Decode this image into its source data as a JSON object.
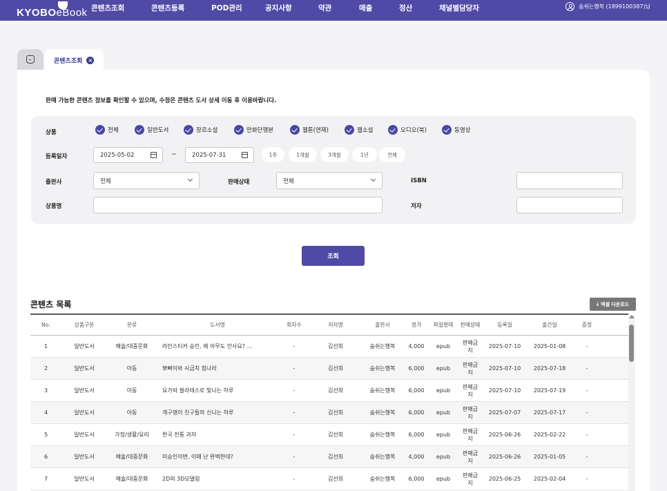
{
  "brand": {
    "bold": "KYOBO",
    "light": "eBook"
  },
  "nav": [
    "콘텐츠조회",
    "콘텐츠등록",
    "POD관리",
    "공지사항",
    "약관",
    "매출",
    "정산",
    "채널별담당자"
  ],
  "user": {
    "label": "숨쉬는행복 (1899100387)님"
  },
  "tab": {
    "label": "콘텐츠조회"
  },
  "notice": "판매 가능한 콘텐츠 정보를 확인할 수 있으며, 수정은 콘텐츠 도서 상세 이동 후 이용바랍니다.",
  "filters": {
    "product_label": "상품",
    "product_options": [
      "전체",
      "일반도서",
      "장르소설",
      "만화단행본",
      "웹툰(연재)",
      "웹소설",
      "오디오(북)",
      "동영상"
    ],
    "date_label": "등록일자",
    "date_from": "2025-05-02",
    "date_sep": "~",
    "date_to": "2025-07-31",
    "period_buttons": [
      "1주",
      "1개월",
      "3개월",
      "1년",
      "전체"
    ],
    "publisher_label": "출판사",
    "publisher_value": "전체",
    "status_label": "판매상태",
    "status_value": "전체",
    "isbn_label": "ISBN",
    "isbn_value": "",
    "title_label": "상품명",
    "title_value": "",
    "author_label": "저자",
    "author_value": ""
  },
  "search_button": "조회",
  "list": {
    "title": "콘텐츠 목록",
    "excel_button": "엑셀 다운로드",
    "columns": [
      "No.",
      "상품구분",
      "분류",
      "도서명",
      "회차수",
      "저자명",
      "출판사",
      "정가",
      "파일형태",
      "판매상태",
      "등록일",
      "출간일",
      "증정"
    ],
    "rows": [
      [
        "1",
        "일반도서",
        "예술/대중문화",
        "라인스티커 승인, 왜 아무도 안사요? ...",
        "-",
        "김선희",
        "숨쉬는행복",
        "4,000",
        "epub",
        "판매금지",
        "2025-07-10",
        "2025-01-08",
        "-"
      ],
      [
        "2",
        "일반도서",
        "아동",
        "뽀빠이와 시금치 힘나라",
        "-",
        "김선희",
        "숨쉬는행복",
        "6,000",
        "epub",
        "판매금지",
        "2025-07-10",
        "2025-07-18",
        "-"
      ],
      [
        "3",
        "일반도서",
        "아동",
        "요가와 필라테스로 빛나는 하루",
        "-",
        "김선희",
        "숨쉬는행복",
        "6,000",
        "epub",
        "판매금지",
        "2025-07-10",
        "2025-07-19",
        "-"
      ],
      [
        "4",
        "일반도서",
        "아동",
        "개구쟁이 친구들의 신나는 하루",
        "-",
        "김선희",
        "숨쉬는행복",
        "6,000",
        "epub",
        "판매금지",
        "2025-07-07",
        "2025-07-17",
        "-"
      ],
      [
        "5",
        "일반도서",
        "가정/생활/요리",
        "한국 전통 과자",
        "-",
        "김선희",
        "숨쉬는행복",
        "6,000",
        "epub",
        "판매금지",
        "2025-06-26",
        "2025-02-22",
        "-"
      ],
      [
        "6",
        "일반도서",
        "예술/대중문화",
        "미승인이면, 이때 난 완벽한데?",
        "-",
        "김선희",
        "숨쉬는행복",
        "4,000",
        "epub",
        "판매금지",
        "2025-06-26",
        "2025-01-05",
        "-"
      ],
      [
        "7",
        "일반도서",
        "예술/대중문화",
        "2D의 3D모델링",
        "-",
        "김선희",
        "숨쉬는행복",
        "6,000",
        "epub",
        "판매금지",
        "2025-06-25",
        "2025-02-04",
        "-"
      ]
    ]
  },
  "colors": {
    "primary": "#4f4aa5",
    "excel": "#777777"
  }
}
